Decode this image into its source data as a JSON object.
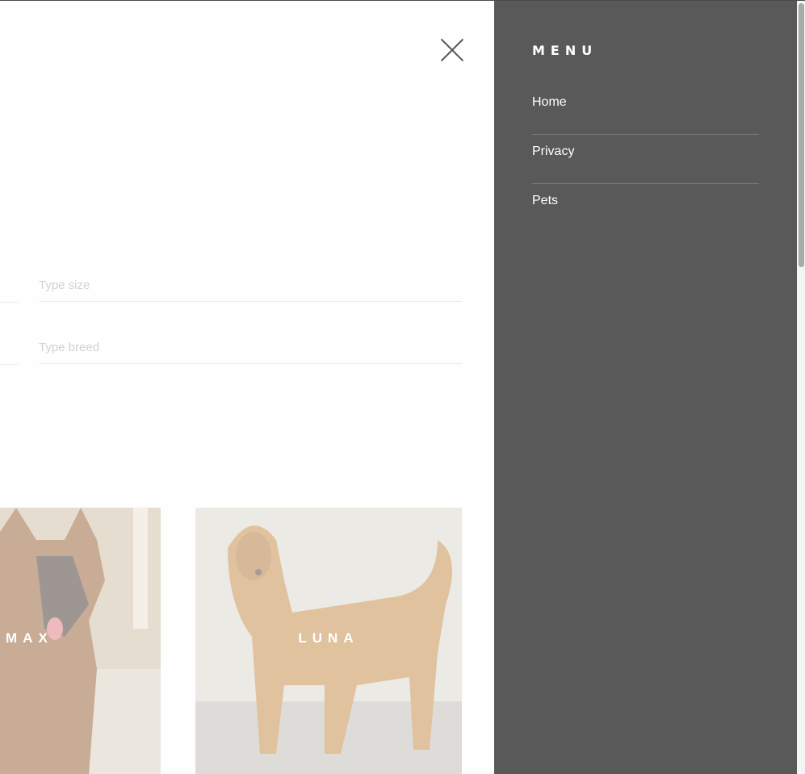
{
  "form": {
    "size_placeholder": "Type size",
    "breed_placeholder": "Type breed"
  },
  "pets": [
    {
      "name": "MAX",
      "breed_hint": "german shepherd"
    },
    {
      "name": "LUNA",
      "breed_hint": "golden retriever"
    }
  ],
  "menu": {
    "title": "MENU",
    "items": [
      {
        "label": "Home"
      },
      {
        "label": "Privacy"
      },
      {
        "label": "Pets"
      }
    ]
  },
  "icons": {
    "close": "close-icon"
  },
  "colors": {
    "menu_bg": "#595959",
    "menu_text": "#ffffff",
    "divider": "#7a7a7a"
  }
}
